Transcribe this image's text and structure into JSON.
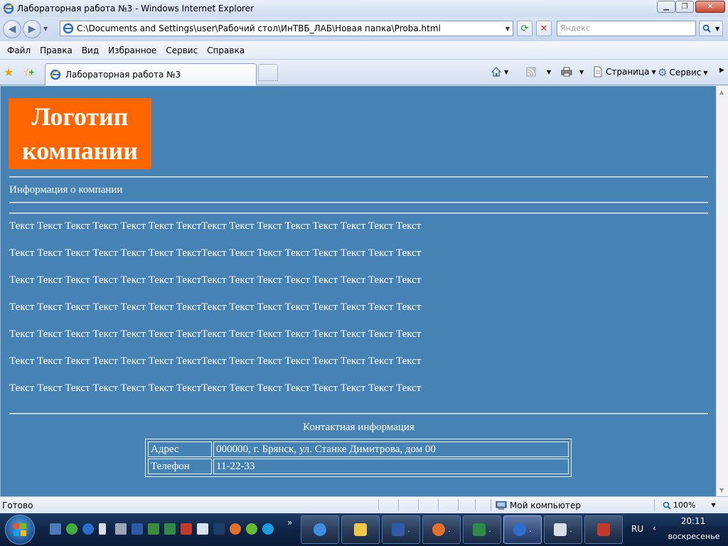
{
  "window": {
    "title": "Лабораторная работа №3 - Windows Internet Explorer"
  },
  "address_bar": {
    "url": "C:\\Documents and Settings\\user\\Рабочий стол\\ИнТВБ_ЛАБ\\Новая папка\\Proba.html",
    "search_placeholder": "Яндекс"
  },
  "menu": {
    "items": [
      "Файл",
      "Правка",
      "Вид",
      "Избранное",
      "Сервис",
      "Справка"
    ]
  },
  "tabs": {
    "active_label": "Лабораторная работа №3"
  },
  "commands": {
    "page_label": "Страница",
    "tools_label": "Сервис"
  },
  "page": {
    "logo_line1": "Логотип",
    "logo_line2": "компании",
    "company_info": "Информация о компании",
    "paragraphs": [
      "Текст Текст Текст Текст Текст Текст ТекстТекст Текст Текст Текст Текст Текст Текст Текст",
      "Текст Текст Текст Текст Текст Текст ТекстТекст Текст Текст Текст Текст Текст Текст Текст",
      "Текст Текст Текст Текст Текст Текст ТекстТекст Текст Текст Текст Текст Текст Текст Текст",
      "Текст Текст Текст Текст Текст Текст ТекстТекст Текст Текст Текст Текст Текст Текст Текст",
      "Текст Текст Текст Текст Текст Текст ТекстТекст Текст Текст Текст Текст Текст Текст Текст",
      "Текст Текст Текст Текст Текст Текст ТекстТекст Текст Текст Текст Текст Текст Текст Текст",
      "Текст Текст Текст Текст Текст Текст ТекстТекст Текст Текст Текст Текст Текст Текст Текст"
    ],
    "contact_title": "Контактная информация",
    "contacts": [
      {
        "key": "Адрес",
        "value": "000000, г. Брянск, ул. Станке Димитрова, дом 00"
      },
      {
        "key": "Телефон",
        "value": "11-22-33"
      }
    ],
    "background_color": "#4682b4",
    "logo_color": "#ff6600"
  },
  "status": {
    "text": "Готово",
    "zone": "Мой компьютер",
    "zoom": "100%"
  },
  "taskbar": {
    "language": "RU",
    "time": "20:11",
    "day": "воскресенье"
  }
}
